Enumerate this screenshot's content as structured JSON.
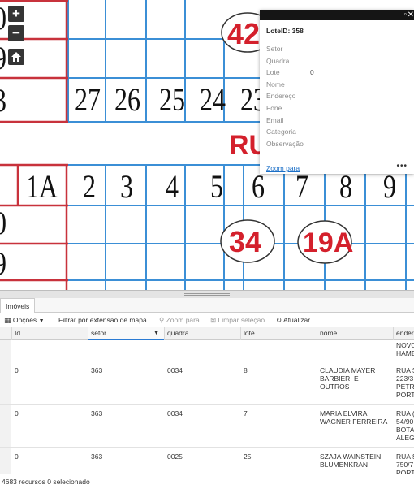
{
  "map": {
    "zoom_in_label": "+",
    "zoom_out_label": "−",
    "home_icon": "home-icon",
    "lot_numbers_row1": [
      "27",
      "26",
      "25",
      "24",
      "23"
    ],
    "lot_numbers_row2": [
      "1A",
      "2",
      "3",
      "4",
      "5",
      "6",
      "7",
      "8",
      "9"
    ],
    "left_numbers": [
      "0",
      "9",
      "3",
      "0",
      "9"
    ],
    "circle_labels": [
      "42",
      "34",
      "19A"
    ],
    "street_fragment": "RU"
  },
  "popup": {
    "title": "LoteID: 358",
    "fields": [
      {
        "label": "Setor",
        "value": ""
      },
      {
        "label": "Quadra",
        "value": ""
      },
      {
        "label": "Lote",
        "value": "0"
      },
      {
        "label": "Nome",
        "value": ""
      },
      {
        "label": "Endereço",
        "value": ""
      },
      {
        "label": "Fone",
        "value": ""
      },
      {
        "label": "Email",
        "value": ""
      },
      {
        "label": "Categoria",
        "value": ""
      },
      {
        "label": "Observação",
        "value": ""
      }
    ],
    "zoom_link": "Zoom para",
    "more_label": "•••",
    "maximize_icon": "maximize-icon",
    "close_icon": "close-icon"
  },
  "table": {
    "tab_label": "Imóveis",
    "toolbar": {
      "options": "Opções",
      "filter": "Filtrar por extensão de mapa",
      "zoom": "Zoom para",
      "clear": "Limpar seleção",
      "refresh": "Atualizar"
    },
    "columns": [
      "Id",
      "setor",
      "quadra",
      "lote",
      "nome",
      "ender"
    ],
    "top_partial": {
      "nome": "",
      "ender": "NOVO\nHAMB"
    },
    "rows": [
      {
        "id": "0",
        "setor": "363",
        "quadra": "0034",
        "lote": "8",
        "nome": "CLAUDIA MAYER BARBIERI E OUTROS",
        "ender": "RUA S\n223/3\nPETRO\nPORT"
      },
      {
        "id": "0",
        "setor": "363",
        "quadra": "0034",
        "lote": "7",
        "nome": "MARIA ELVIRA WAGNER FERREIRA",
        "ender": "RUA (\n54/90\nBOTA\nALEG"
      },
      {
        "id": "0",
        "setor": "363",
        "quadra": "0025",
        "lote": "25",
        "nome": "SZAJA WAINSTEIN BLUMENKRAN",
        "ender": "RUA S\n750/7\nPORT"
      }
    ],
    "status": "4683 recursos 0 selecionado"
  }
}
